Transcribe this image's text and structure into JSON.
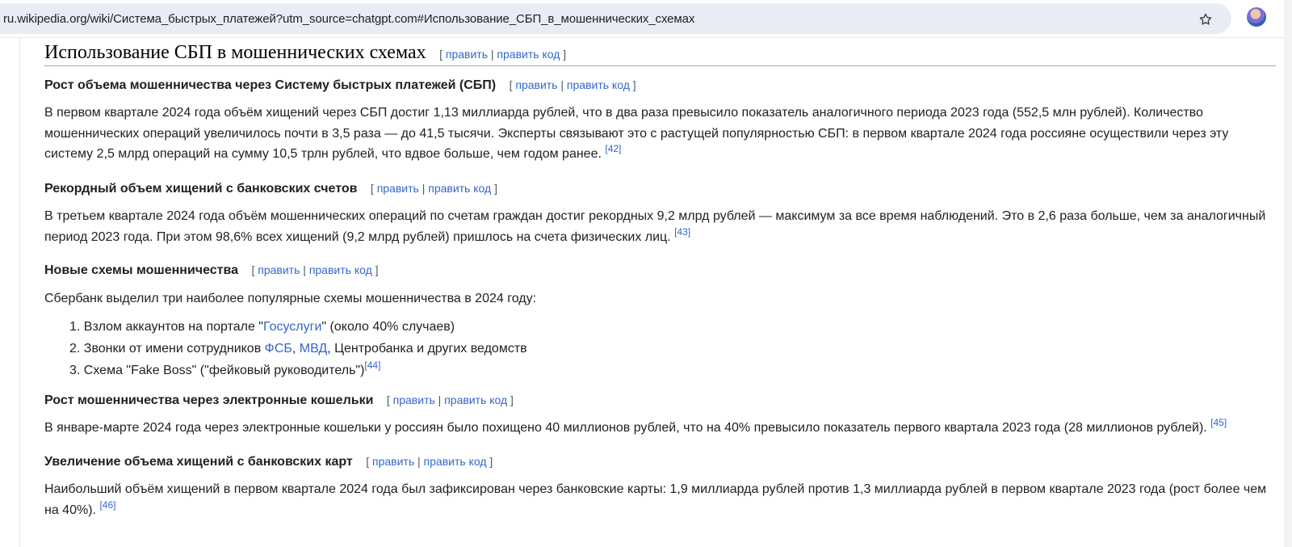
{
  "browser": {
    "url": "ru.wikipedia.org/wiki/Система_быстрых_платежей?utm_source=chatgpt.com#Использование_СБП_в_мошеннических_схемах"
  },
  "edit": {
    "open": "[",
    "edit_label": "править",
    "sep": "|",
    "edit_code_label": "править код",
    "close": "]"
  },
  "section": {
    "title": "Использование СБП в мошеннических схемах"
  },
  "subsections": [
    {
      "title": "Рост объема мошенничества через Систему быстрых платежей (СБП)",
      "text": "В первом квартале 2024 года объём хищений через СБП достиг 1,13 миллиарда рублей, что в два раза превысило показатель аналогичного периода 2023 года (552,5 млн рублей). Количество мошеннических операций увеличилось почти в 3,5 раза — до 41,5 тысячи. Эксперты связывают это с растущей популярностью СБП: в первом квартале 2024 года россияне осуществили через эту систему 2,5 млрд операций на сумму 10,5 трлн рублей, что вдвое больше, чем годом ранее.",
      "ref": "[42]"
    },
    {
      "title": "Рекордный объем хищений с банковских счетов",
      "text": "В третьем квартале 2024 года объём мошеннических операций по счетам граждан достиг рекордных 9,2 млрд рублей — максимум за все время наблюдений. Это в 2,6 раза больше, чем за аналогичный период 2023 года. При этом 98,6% всех хищений (9,2 млрд рублей) пришлось на счета физических лиц.",
      "ref": "[43]"
    },
    {
      "title": "Новые схемы мошенничества",
      "intro": "Сбербанк выделил три наиболее популярные схемы мошенничества в 2024 году:",
      "items": [
        {
          "num": "1.",
          "before": "Взлом аккаунтов на портале \"",
          "link": "Госуслуги",
          "after": "\" (около 40% случаев)"
        },
        {
          "num": "2.",
          "before": "Звонки от имени сотрудников ",
          "link": "ФСБ",
          "mid": ", ",
          "link2": "МВД",
          "after": ", Центробанка и других ведомств"
        },
        {
          "num": "3.",
          "before": "Схема \"Fake Boss\" (\"фейковый руководитель\")",
          "ref": "[44]"
        }
      ]
    },
    {
      "title": "Рост мошенничества через электронные кошельки",
      "text": "В январе-марте 2024 года через электронные кошельки у россиян было похищено 40 миллионов рублей, что на 40% превысило показатель первого квартала 2023 года (28 миллионов рублей).",
      "ref": "[45]"
    },
    {
      "title": "Увеличение объема хищений с банковских карт",
      "text": "Наибольший объём хищений в первом квартале 2024 года был зафиксирован через банковские карты: 1,9 миллиарда рублей против 1,3 миллиарда рублей в первом квартале 2023 года (рост более чем на 40%).",
      "ref": "[46]"
    }
  ],
  "colors": {
    "link": "#3366cc",
    "text": "#202122",
    "url_bar": "#e8edf5"
  },
  "icons": [
    "star-icon",
    "avatar"
  ]
}
